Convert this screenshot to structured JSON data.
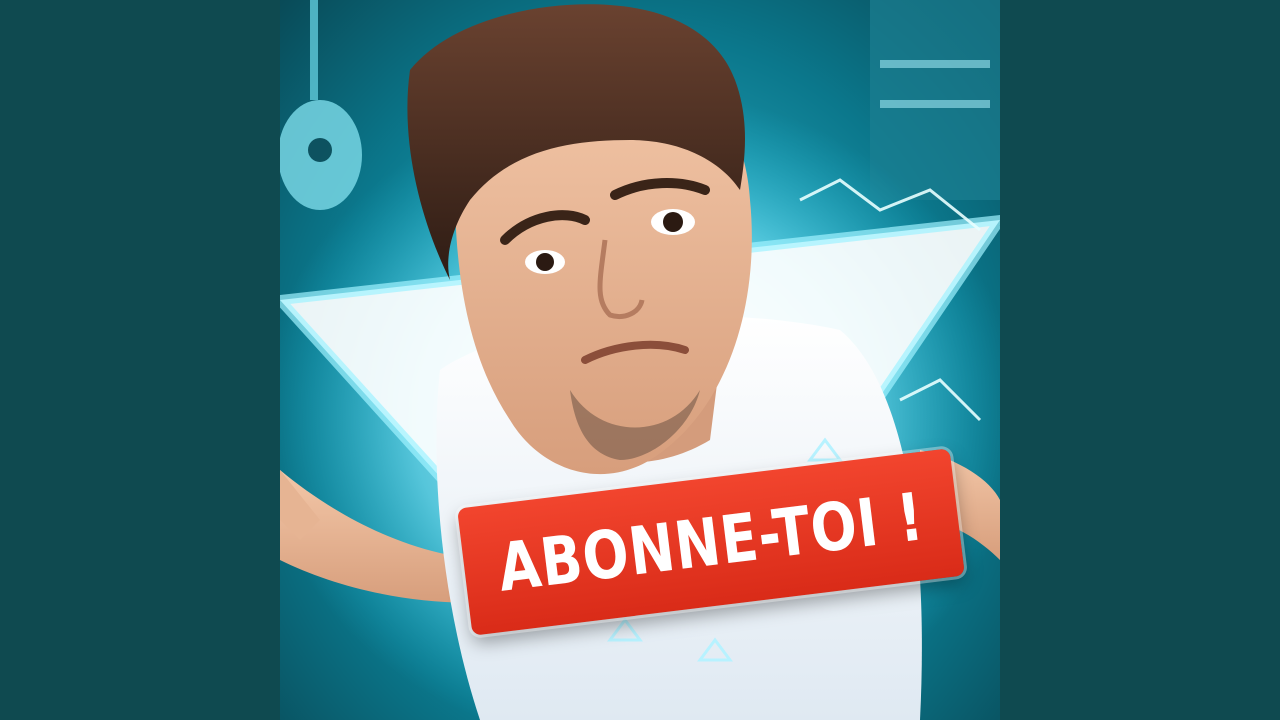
{
  "thumbnail": {
    "badge_text": "ABONNE-TOI !"
  },
  "colors": {
    "side_bars": "#0f4a50",
    "glow": "#33d6f0",
    "badge": "#e0341f",
    "badge_text": "#ffffff"
  }
}
